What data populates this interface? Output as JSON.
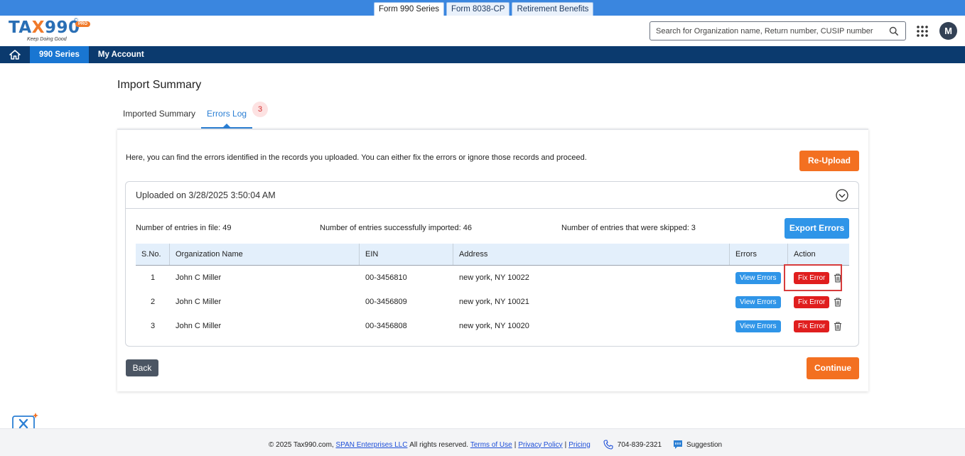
{
  "product_tabs": [
    {
      "label": "Form 990 Series",
      "active": true
    },
    {
      "label": "Form 8038-CP",
      "active": false
    },
    {
      "label": "Retirement Benefits",
      "active": false
    }
  ],
  "header": {
    "logo_text_a": "TA",
    "logo_text_x": "X",
    "logo_text_b": "990",
    "logo_copy": "©",
    "logo_pro": "PRO",
    "logo_tagline": "Keep Doing Good",
    "search_placeholder": "Search for Organization name, Return number, CUSIP number",
    "avatar_initial": "M"
  },
  "nav": {
    "items": [
      {
        "label": "990 Series",
        "active": true
      },
      {
        "label": "My Account",
        "active": false
      }
    ]
  },
  "page": {
    "title": "Import Summary",
    "tabs": [
      {
        "label": "Imported Summary",
        "active": false
      },
      {
        "label": "Errors Log",
        "active": true,
        "badge": "3"
      }
    ],
    "intro": "Here, you can find the errors identified in the records you uploaded. You can either fix the errors or ignore those records and proceed.",
    "reupload_label": "Re-Upload",
    "upload": {
      "title": "Uploaded on 3/28/2025 3:50:04 AM",
      "stats": {
        "total": "Number of entries in file: 49",
        "imported": "Number of entries successfully imported: 46",
        "skipped": "Number of entries that were skipped: 3"
      },
      "export_label": "Export Errors",
      "columns": [
        "S.No.",
        "Organization Name",
        "EIN",
        "Address",
        "Errors",
        "Action"
      ],
      "rows": [
        {
          "sno": "1",
          "org": "John C Miller",
          "ein": "00-3456810",
          "address": "new york, NY 10022",
          "view": "View Errors",
          "fix": "Fix Error"
        },
        {
          "sno": "2",
          "org": "John C Miller",
          "ein": "00-3456809",
          "address": "new york, NY 10021",
          "view": "View Errors",
          "fix": "Fix Error"
        },
        {
          "sno": "3",
          "org": "John C Miller",
          "ein": "00-3456808",
          "address": "new york, NY 10020",
          "view": "View Errors",
          "fix": "Fix Error"
        }
      ]
    },
    "back_label": "Back",
    "continue_label": "Continue"
  },
  "footer": {
    "copyright": "© 2025 Tax990.com,",
    "company": "SPAN Enterprises LLC",
    "rights": "All rights reserved.",
    "terms": "Terms of Use",
    "privacy": "Privacy Policy",
    "pricing": "Pricing",
    "phone": "704-839-2321",
    "suggestion": "Suggestion"
  },
  "colors": {
    "brand_blue": "#0b3a6e",
    "accent_orange": "#f37021",
    "button_blue": "#2f95e8",
    "error_red": "#e01e1e"
  }
}
